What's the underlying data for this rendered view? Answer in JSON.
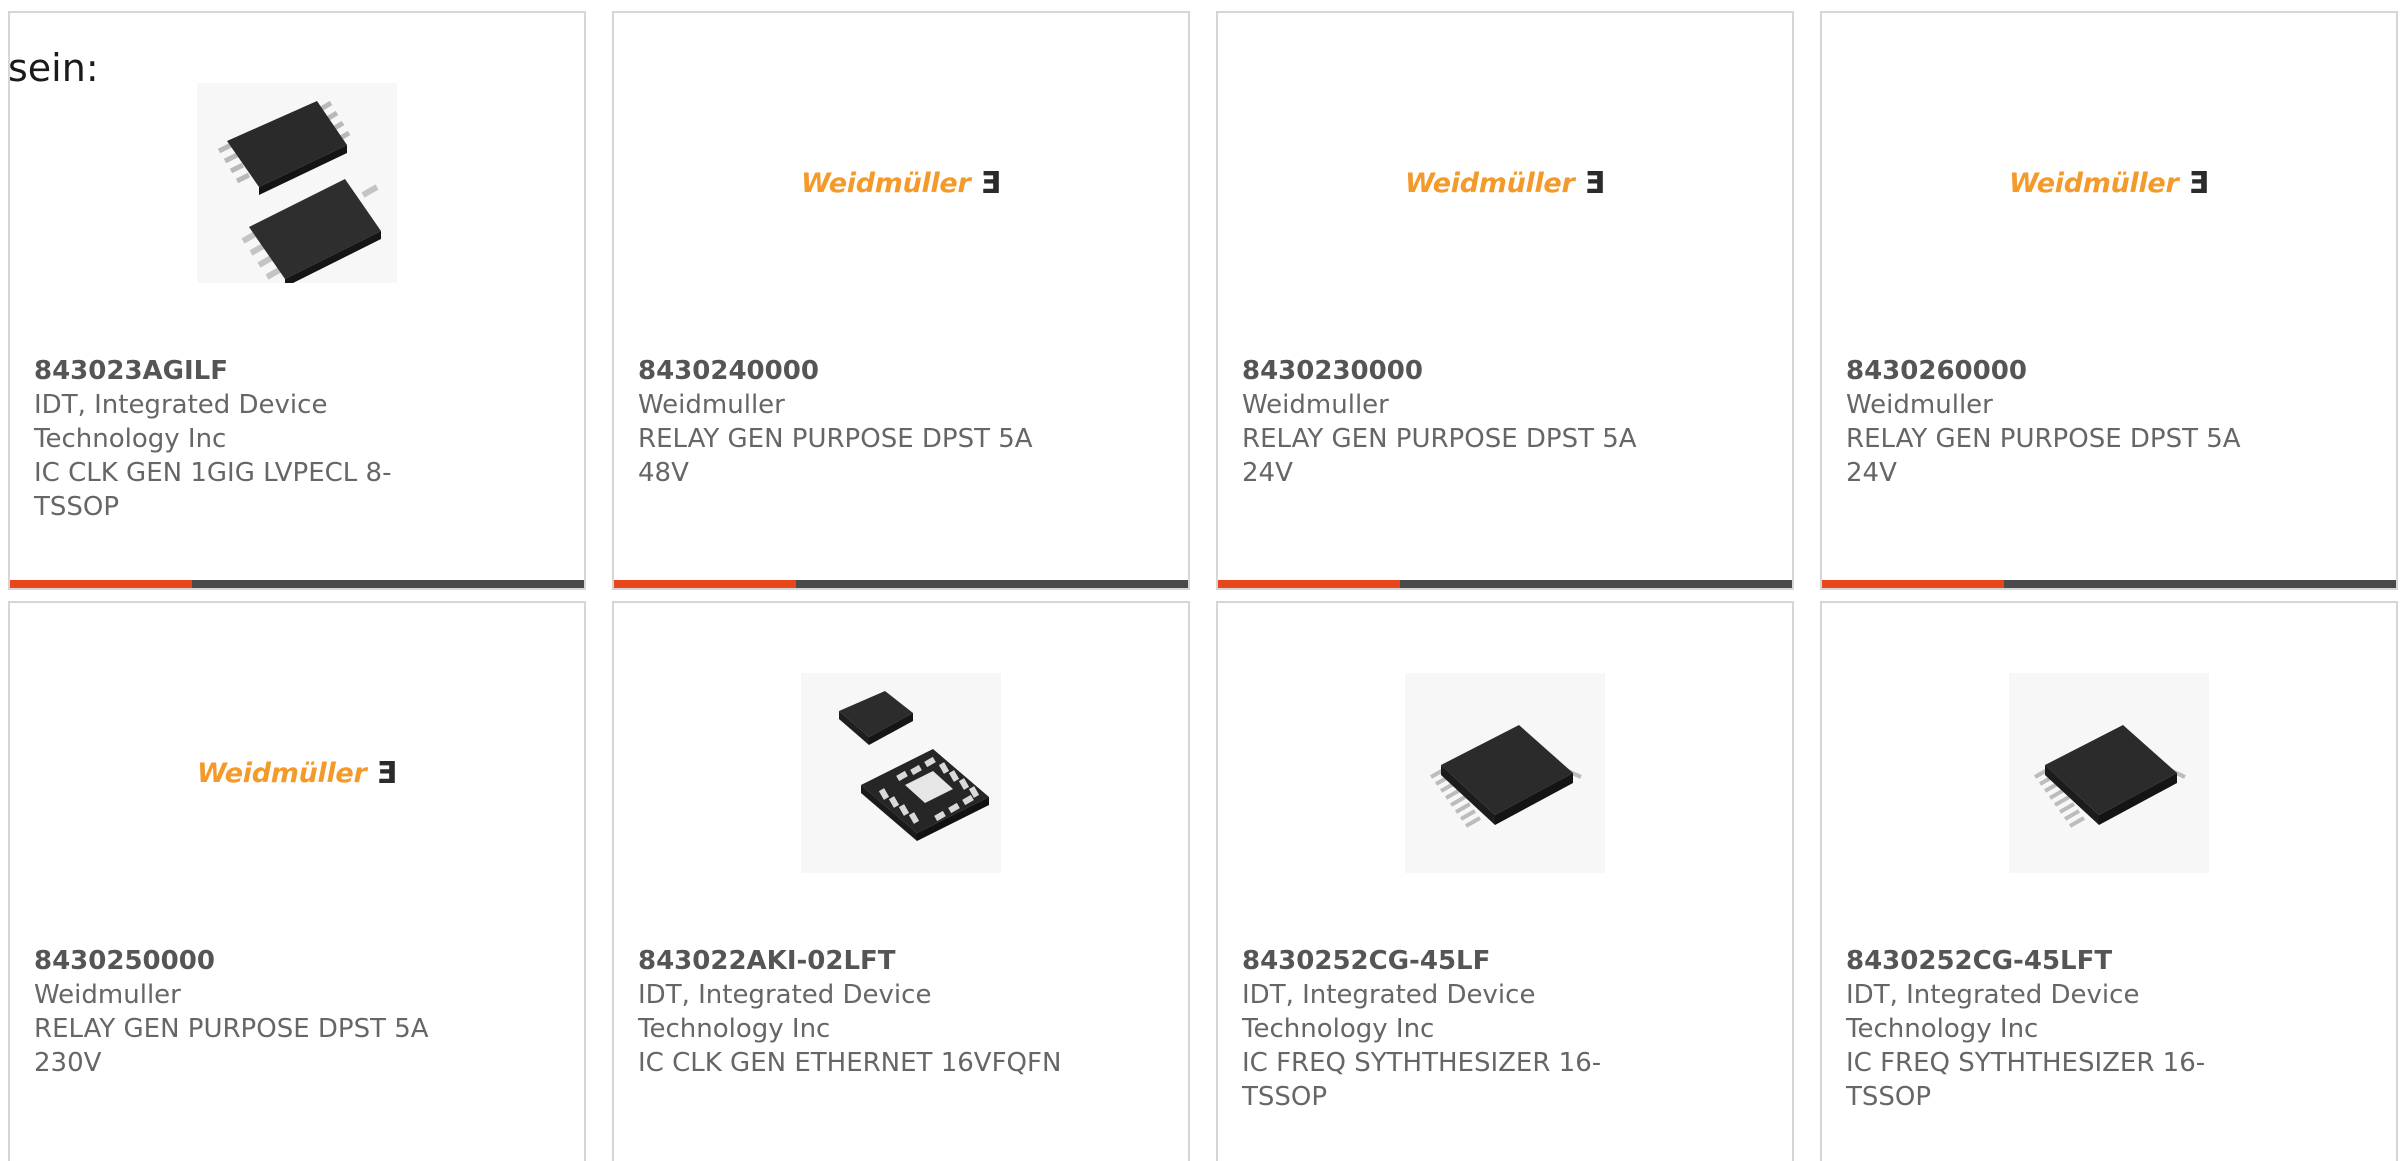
{
  "intro_text": "sein:",
  "colors": {
    "accent_bar": "#e8471c",
    "dark_bar": "#4a4a4a",
    "weidmuller_orange": "#f39a2a"
  },
  "logo": {
    "word": "Weidmüller",
    "mark": "Ǝ"
  },
  "products": [
    {
      "part_number": "843023AGILF",
      "manufacturer": "IDT, Integrated Device Technology Inc",
      "description": "IC CLK GEN 1GIG LVPECL 8-TSSOP",
      "image": "chip-tssop8-icon"
    },
    {
      "part_number": "8430240000",
      "manufacturer": "Weidmuller",
      "description": "RELAY GEN PURPOSE DPST 5A 48V",
      "image": "weidmuller-logo"
    },
    {
      "part_number": "8430230000",
      "manufacturer": "Weidmuller",
      "description": "RELAY GEN PURPOSE DPST 5A 24V",
      "image": "weidmuller-logo"
    },
    {
      "part_number": "8430260000",
      "manufacturer": "Weidmuller",
      "description": "RELAY GEN PURPOSE DPST 5A 24V",
      "image": "weidmuller-logo"
    },
    {
      "part_number": "8430250000",
      "manufacturer": "Weidmuller",
      "description": "RELAY GEN PURPOSE DPST 5A 230V",
      "image": "weidmuller-logo"
    },
    {
      "part_number": "843022AKI-02LFT",
      "manufacturer": "IDT, Integrated Device Technology Inc",
      "description": "IC CLK GEN ETHERNET 16VFQFN",
      "image": "chip-vfqfn16-icon"
    },
    {
      "part_number": "8430252CG-45LF",
      "manufacturer": "IDT, Integrated Device Technology Inc",
      "description": "IC FREQ SYTHTHESIZER 16-TSSOP",
      "image": "chip-tssop16-icon"
    },
    {
      "part_number": "8430252CG-45LFT",
      "manufacturer": "IDT, Integrated Device Technology Inc",
      "description": "IC FREQ SYTHTHESIZER 16-TSSOP",
      "image": "chip-tssop16-icon"
    }
  ]
}
